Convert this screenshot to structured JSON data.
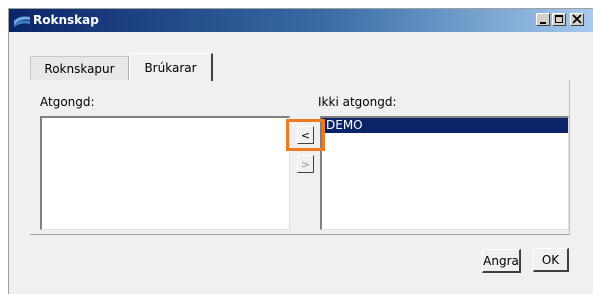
{
  "window": {
    "title": "Roknskap",
    "controls": [
      "minimize",
      "maximize",
      "close"
    ]
  },
  "tabs": [
    {
      "label": "Roknskapur",
      "active": false
    },
    {
      "label": "Brúkarar",
      "active": true
    }
  ],
  "panel": {
    "left_label": "Atgongd:",
    "right_label": "Ikki atgongd:",
    "left_items": [],
    "right_items": [
      {
        "label": "DEMO",
        "selected": true
      }
    ],
    "move_left_label": "<",
    "move_right_label": ">"
  },
  "buttons": {
    "cancel_label": "Angra",
    "ok_label": "OK"
  },
  "colors": {
    "highlight": "#f07a1e",
    "selection": "#0a246a"
  }
}
